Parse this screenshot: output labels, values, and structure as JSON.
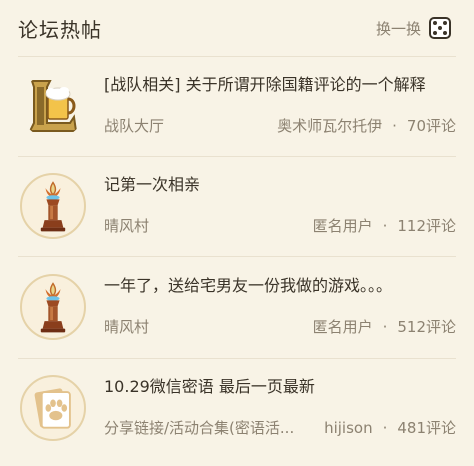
{
  "header": {
    "title": "论坛热帖",
    "refresh_label": "换一换",
    "refresh_icon": "dice-icon"
  },
  "posts": [
    {
      "title": "[战队相关] 关于所谓开除国籍评论的一个解释",
      "forum": "战队大厅",
      "author": "奥术师瓦尔托伊",
      "separator": "·",
      "comments": "70评论",
      "avatar_icon": "lol-logo-icon"
    },
    {
      "title": "记第一次相亲",
      "forum": "晴风村",
      "author": "匿名用户",
      "separator": "·",
      "comments": "112评论",
      "avatar_icon": "torch-trophy-icon"
    },
    {
      "title": "一年了，送给宅男友一份我做的游戏。。。",
      "forum": "晴风村",
      "author": "匿名用户",
      "separator": "·",
      "comments": "512评论",
      "avatar_icon": "torch-trophy-icon"
    },
    {
      "title": "10.29微信密语 最后一页最新",
      "forum": "分享链接/活动合集(密语活...",
      "author": "hijison",
      "separator": "·",
      "comments": "481评论",
      "avatar_icon": "card-paw-icon"
    }
  ],
  "colors": {
    "background": "#f8f3e6",
    "text_primary": "#3a3328",
    "text_secondary": "#8c8271",
    "divider": "#e9e1cf"
  }
}
